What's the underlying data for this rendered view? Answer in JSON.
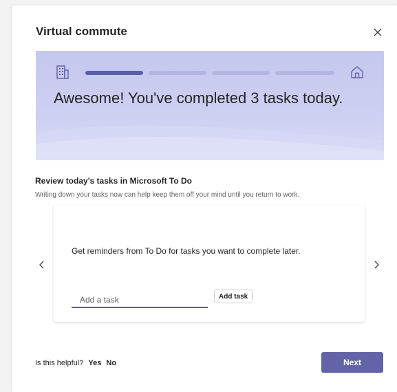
{
  "dialog": {
    "title": "Virtual commute"
  },
  "banner": {
    "message": "Awesome! You've completed 3 tasks today.",
    "progress": {
      "segments_total": 4,
      "segments_completed": 1
    },
    "start_icon": "office-building-icon",
    "end_icon": "home-icon"
  },
  "section": {
    "heading": "Review today's tasks in Microsoft To Do",
    "subtext": "Writing down your tasks now can help keep them off your mind until you return to work."
  },
  "card": {
    "text": "Get reminders from To Do for tasks you want to complete later.",
    "input_placeholder": "Add a task",
    "input_value": "",
    "add_button_label": "Add task"
  },
  "footer": {
    "question": "Is this helpful?",
    "yes_label": "Yes",
    "no_label": "No",
    "next_label": "Next"
  },
  "colors": {
    "accent": "#6264a7",
    "banner_background": "#c5c8ee",
    "text_primary": "#242424",
    "text_secondary": "#616161"
  }
}
